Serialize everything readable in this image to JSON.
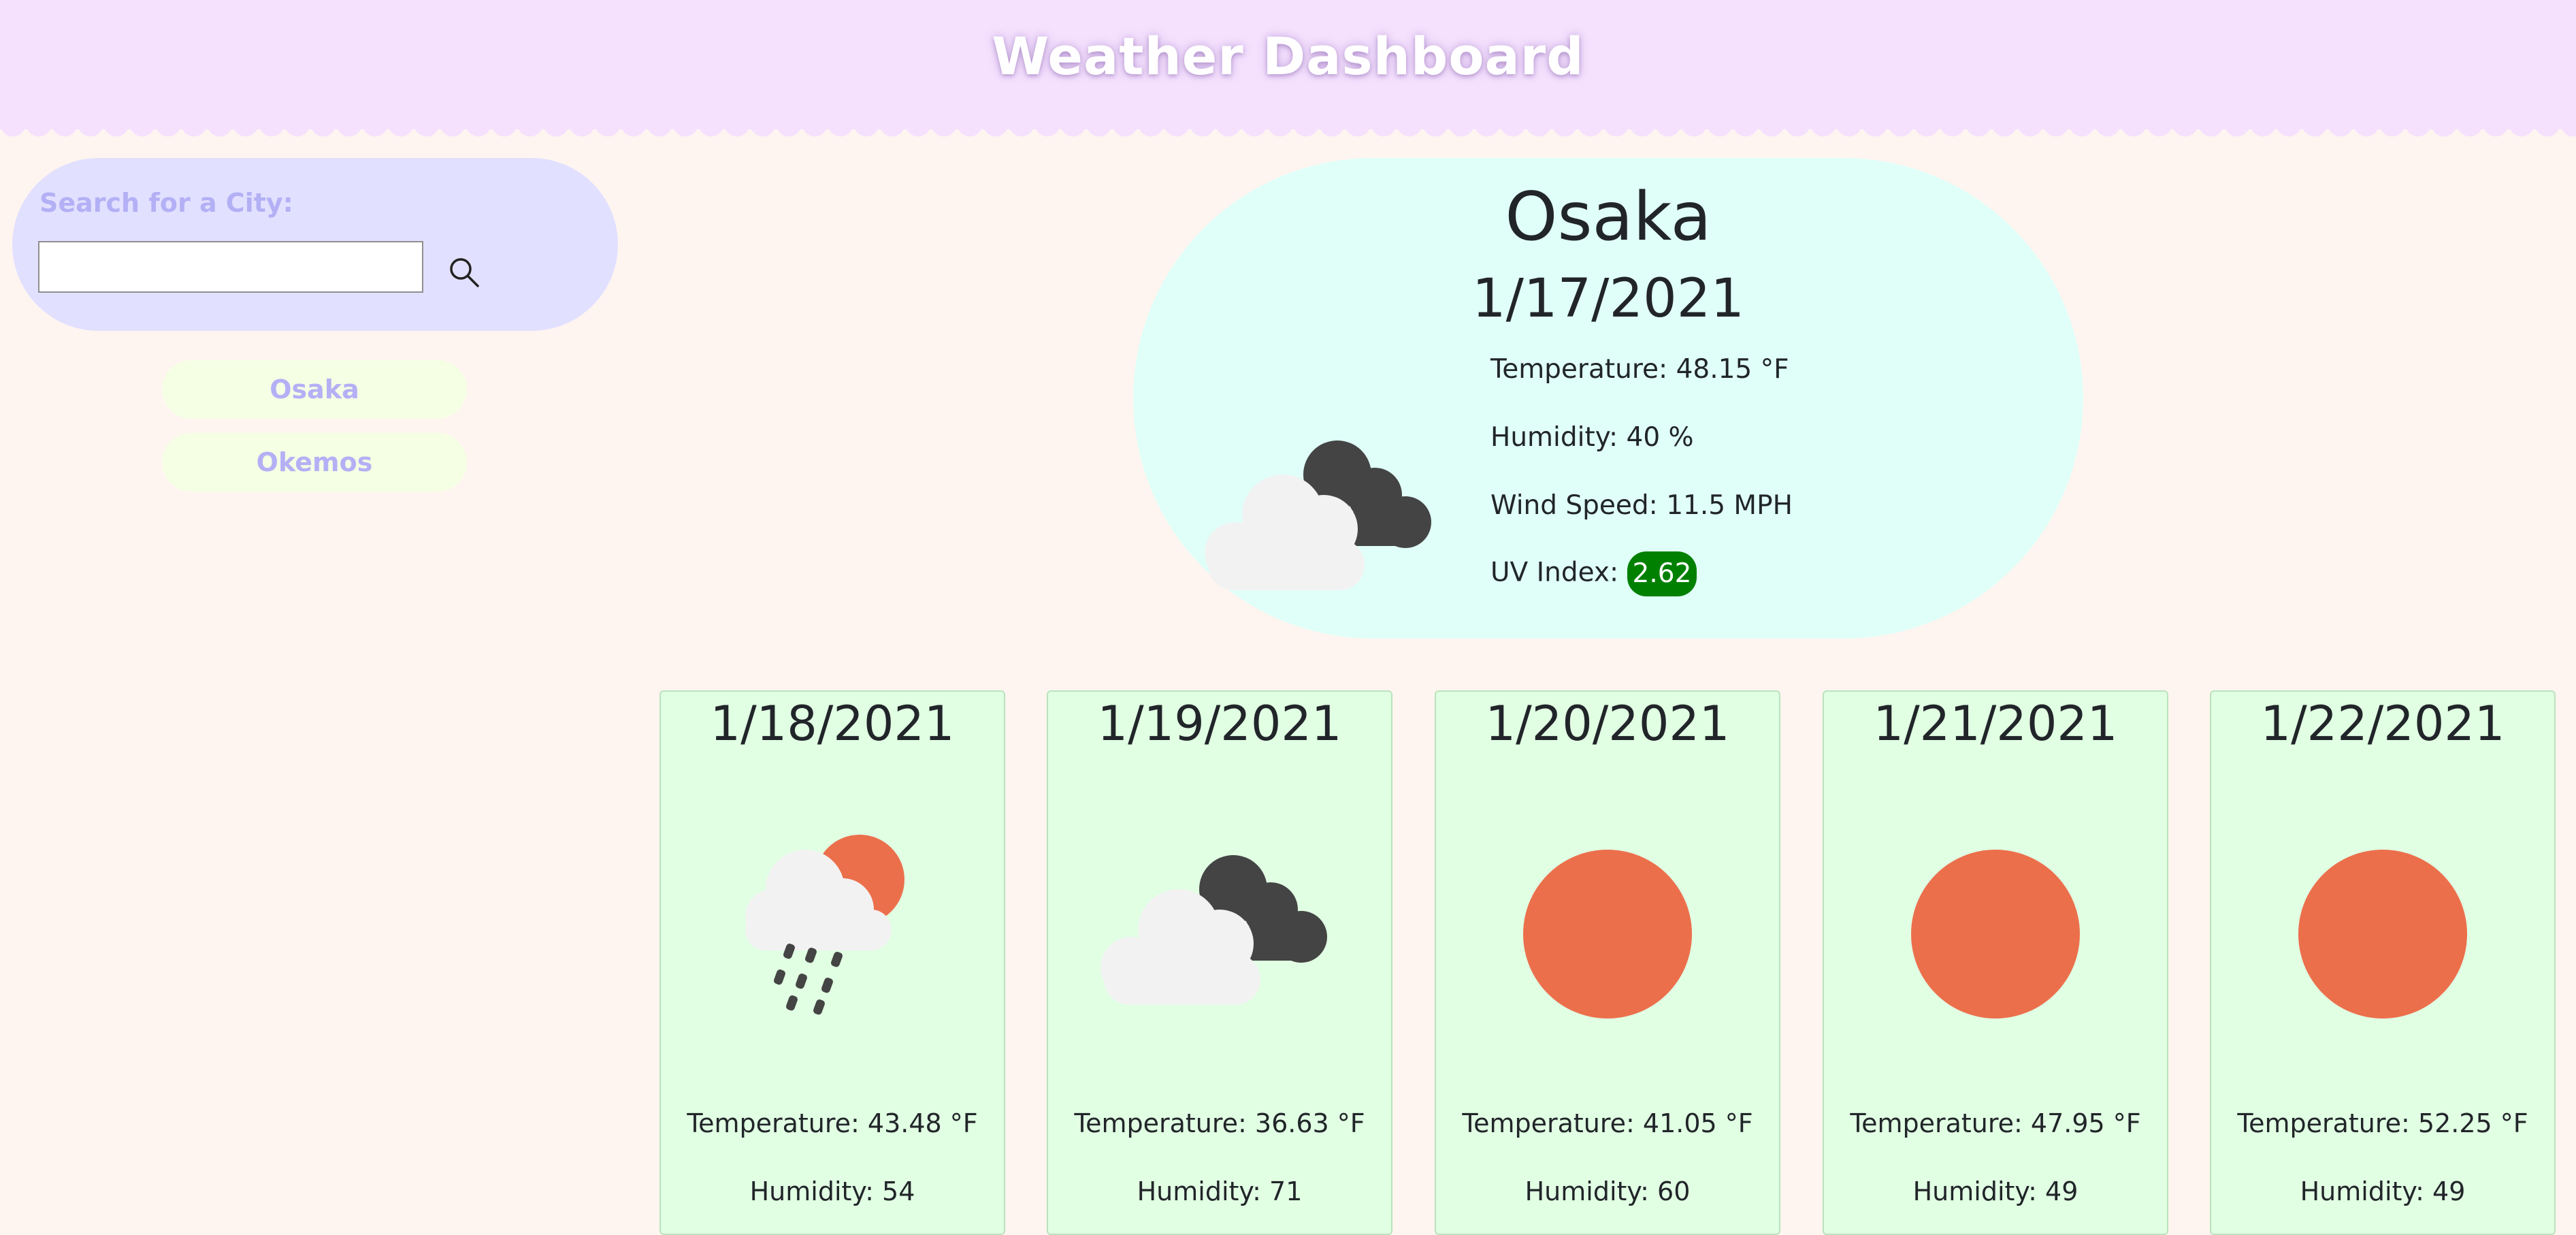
{
  "header": {
    "title": "Weather Dashboard"
  },
  "search": {
    "label": "Search for a City:",
    "value": "",
    "placeholder": ""
  },
  "history": [
    {
      "label": "Osaka"
    },
    {
      "label": "Okemos"
    }
  ],
  "current": {
    "city": "Osaka",
    "date": "1/17/2021",
    "temperature": "Temperature: 48.15 °F",
    "humidity": "Humidity: 40 %",
    "wind": "Wind Speed: 11.5 MPH",
    "uv_label": "UV Index:",
    "uv_value": "2.62",
    "icon": "cloudy-icon"
  },
  "forecast": [
    {
      "date": "1/18/2021",
      "icon": "rain-sun-cloud-icon",
      "temperature": "Temperature: 43.48 °F",
      "humidity": "Humidity: 54"
    },
    {
      "date": "1/19/2021",
      "icon": "cloudy-icon",
      "temperature": "Temperature: 36.63 °F",
      "humidity": "Humidity: 71"
    },
    {
      "date": "1/20/2021",
      "icon": "sun-icon",
      "temperature": "Temperature: 41.05 °F",
      "humidity": "Humidity: 60"
    },
    {
      "date": "1/21/2021",
      "icon": "sun-icon",
      "temperature": "Temperature: 47.95 °F",
      "humidity": "Humidity: 49"
    },
    {
      "date": "1/22/2021",
      "icon": "sun-icon",
      "temperature": "Temperature: 52.25 °F",
      "humidity": "Humidity: 49"
    }
  ],
  "colors": {
    "header_bg": "#f5e1fe",
    "page_bg": "#fff5f0",
    "search_panel_bg": "#e2e0ff",
    "accent_text": "#b3b0f5",
    "city_button_bg": "#f4ffe4",
    "current_card_bg": "#e0fff9",
    "forecast_card_bg": "#e1ffe3",
    "uv_badge": "#008000",
    "sun": "#ec6f4c",
    "dark_cloud": "#444444",
    "light_cloud": "#f2f2f2"
  }
}
